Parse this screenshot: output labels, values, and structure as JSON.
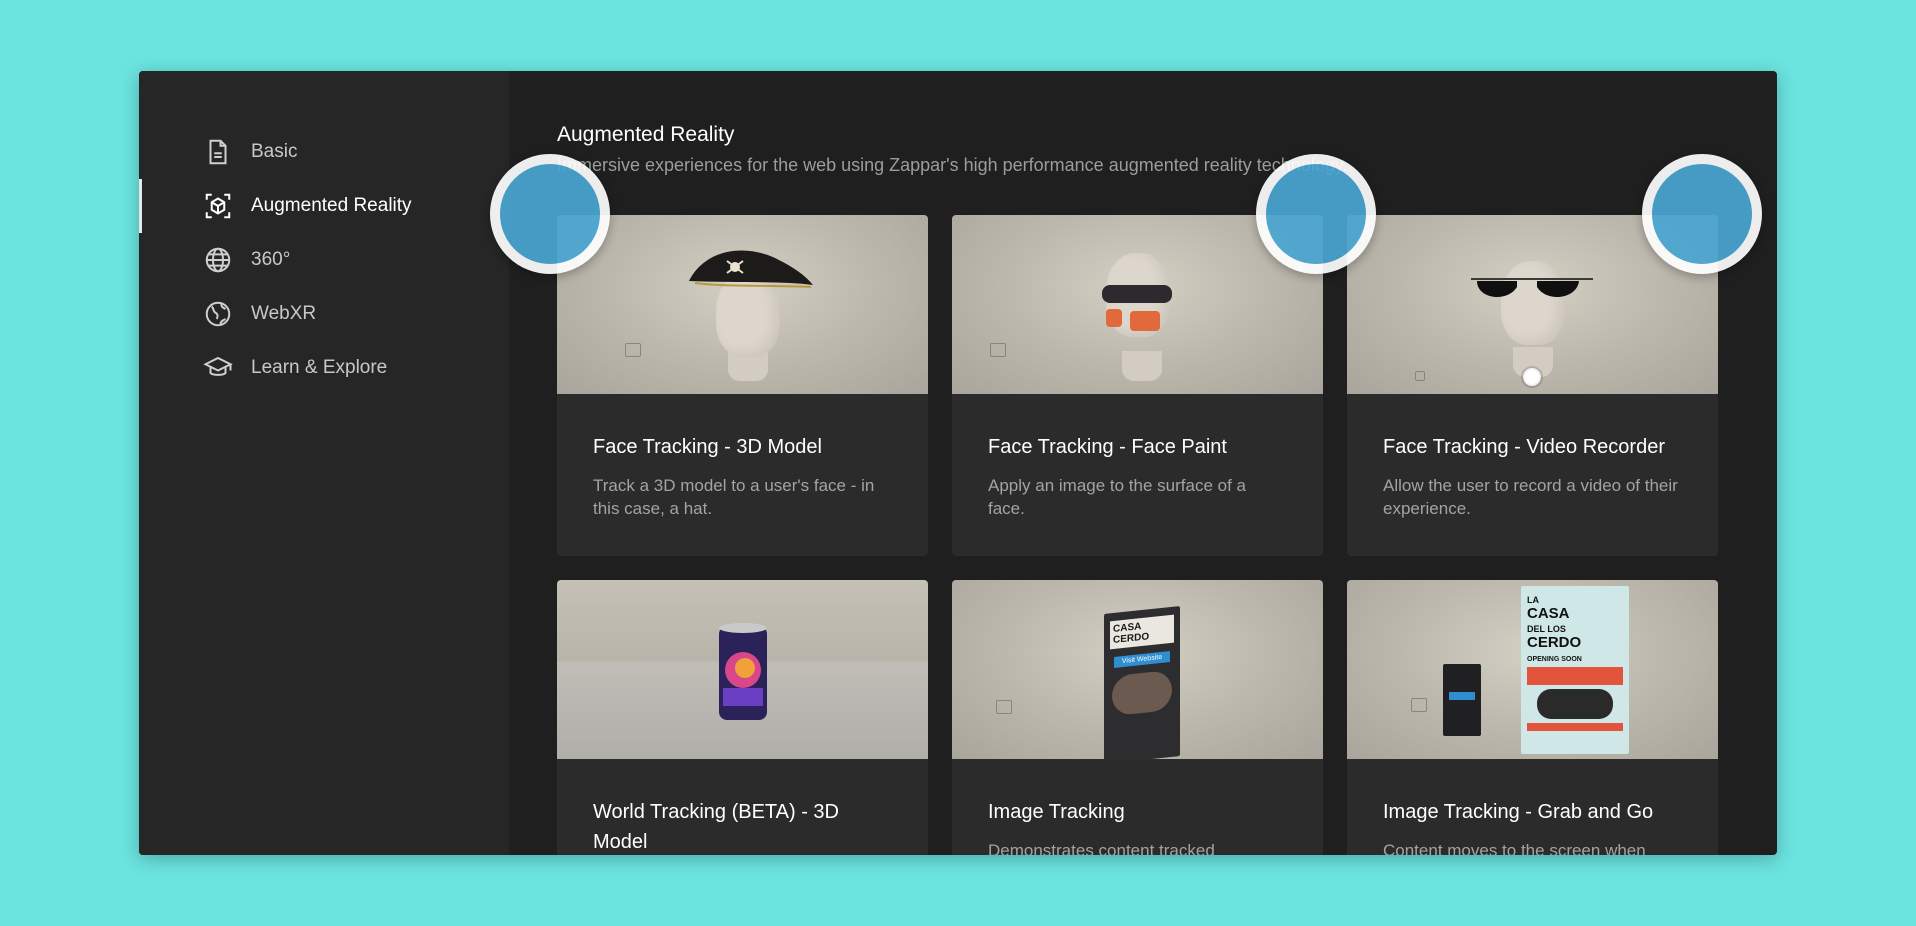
{
  "sidebar": {
    "items": [
      {
        "label": "Basic",
        "icon": "document-icon",
        "active": false
      },
      {
        "label": "Augmented Reality",
        "icon": "ar-cube-icon",
        "active": true
      },
      {
        "label": "360°",
        "icon": "globe-grid-icon",
        "active": false
      },
      {
        "label": "WebXR",
        "icon": "earth-icon",
        "active": false
      },
      {
        "label": "Learn & Explore",
        "icon": "graduation-cap-icon",
        "active": false
      }
    ]
  },
  "section": {
    "title": "Augmented Reality",
    "description": "Immersive experiences for the web using Zappar's high performance augmented reality technology."
  },
  "cards": [
    {
      "title": "Face Tracking - 3D Model",
      "text": "Track a 3D model to a user's face - in this case, a hat."
    },
    {
      "title": "Face Tracking - Face Paint",
      "text": "Apply an image to the surface of a face."
    },
    {
      "title": "Face Tracking - Video Recorder",
      "text": "Allow the user to record a video of their experience."
    },
    {
      "title": "World Tracking (BETA) - 3D Model",
      "text": ""
    },
    {
      "title": "Image Tracking",
      "text": "Demonstrates content tracked"
    },
    {
      "title": "Image Tracking - Grab and Go",
      "text": "Content moves to the screen when"
    }
  ],
  "poster": {
    "line1": "LA",
    "line2": "CASA",
    "line3": "DEL LOS",
    "line4": "CERDO",
    "line5": "OPENING SOON",
    "button": "Visit Website"
  },
  "colors": {
    "background": "#6be3df",
    "sidebar": "#262626",
    "main": "#1f1f1f",
    "card": "#2b2b2b",
    "overlay_dot": "#4aa6d2"
  }
}
